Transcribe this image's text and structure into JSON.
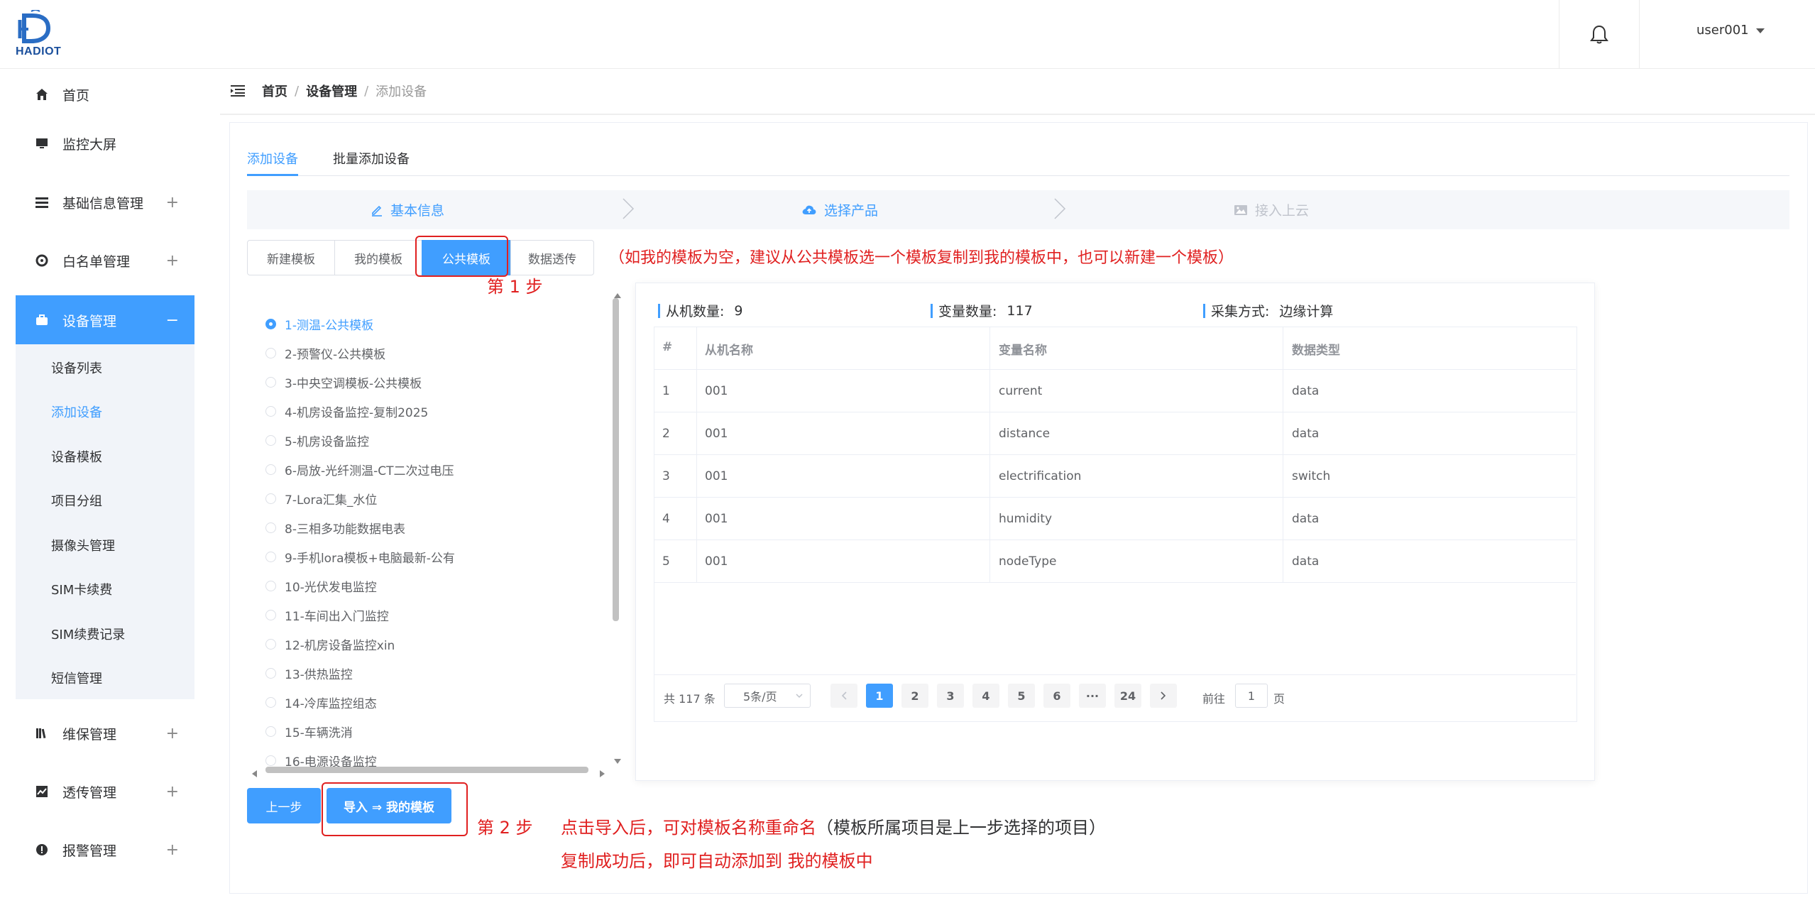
{
  "header": {
    "logo_text": "HADIOT",
    "user_name": "user001"
  },
  "sidebar": {
    "items": [
      {
        "label": "首页",
        "icon": "home-icon"
      },
      {
        "label": "监控大屏",
        "icon": "monitor-icon"
      },
      {
        "label": "基础信息管理",
        "icon": "list-icon",
        "expandable": true
      },
      {
        "label": "白名单管理",
        "icon": "target-icon",
        "expandable": true
      },
      {
        "label": "设备管理",
        "icon": "briefcase-icon",
        "expandable": true,
        "active": true
      },
      {
        "label": "维保管理",
        "icon": "books-icon",
        "expandable": true
      },
      {
        "label": "透传管理",
        "icon": "chart-icon",
        "expandable": true
      },
      {
        "label": "报警管理",
        "icon": "alert-icon",
        "expandable": true
      }
    ],
    "plus": "+",
    "minus": "−",
    "sub_items": [
      "设备列表",
      "添加设备",
      "设备模板",
      "项目分组",
      "摄像头管理",
      "SIM卡续费",
      "SIM续费记录",
      "短信管理"
    ],
    "active_sub": "添加设备"
  },
  "breadcrumb": {
    "home": "首页",
    "section": "设备管理",
    "current": "添加设备",
    "separator": "/"
  },
  "tabs": [
    "添加设备",
    "批量添加设备"
  ],
  "steps": [
    "基本信息",
    "选择产品",
    "接入上云"
  ],
  "template_tabs": [
    "新建模板",
    "我的模板",
    "公共模板",
    "数据透传"
  ],
  "annotations": {
    "hint": "（如我的模板为空，建议从公共模板选一个模板复制到我的模板中，也可以新建一个模板）",
    "step1": "第 1 步",
    "step2": "第 2 步",
    "step2_note1": "点击导入后，可对模板名称重命名",
    "step2_note1b": "（模板所属项目是上一步选择的项目）",
    "step2_note2": "复制成功后，即可自动添加到 我的模板中"
  },
  "templates": [
    "1-测温-公共模板",
    "2-预警仪-公共模板",
    "3-中央空调模板-公共模板",
    "4-机房设备监控-复制2025",
    "5-机房设备监控",
    "6-局放-光纤测温-CT二次过电压",
    "7-Lora汇集_水位",
    "8-三相多功能数据电表",
    "9-手机lora模板+电脑最新-公有",
    "10-光伏发电监控",
    "11-车间出入门监控",
    "12-机房设备监控xin",
    "13-供热监控",
    "14-冷库监控组态",
    "15-车辆洗消",
    "16-电源设备监控"
  ],
  "selected_template": "1-测温-公共模板",
  "stats": {
    "slave_label": "从机数量:",
    "slave_value": "9",
    "var_label": "变量数量:",
    "var_value": "117",
    "method_label": "采集方式:",
    "method_value": "边缘计算"
  },
  "table": {
    "headers": [
      "#",
      "从机名称",
      "变量名称",
      "数据类型"
    ],
    "rows": [
      [
        "1",
        "001",
        "current",
        "data"
      ],
      [
        "2",
        "001",
        "distance",
        "data"
      ],
      [
        "3",
        "001",
        "electrification",
        "switch"
      ],
      [
        "4",
        "001",
        "humidity",
        "data"
      ],
      [
        "5",
        "001",
        "nodeType",
        "data"
      ]
    ]
  },
  "pagination": {
    "total": "共 117 条",
    "page_size": "5条/页",
    "pages": [
      "1",
      "2",
      "3",
      "4",
      "5",
      "6",
      "···",
      "24"
    ],
    "current": "1",
    "goto_label": "前往",
    "goto_value": "1",
    "page_suffix": "页"
  },
  "buttons": {
    "prev": "上一步",
    "import": "导入 ⇒ 我的模板"
  },
  "colors": {
    "primary": "#409eff",
    "annotation": "#e02020"
  }
}
